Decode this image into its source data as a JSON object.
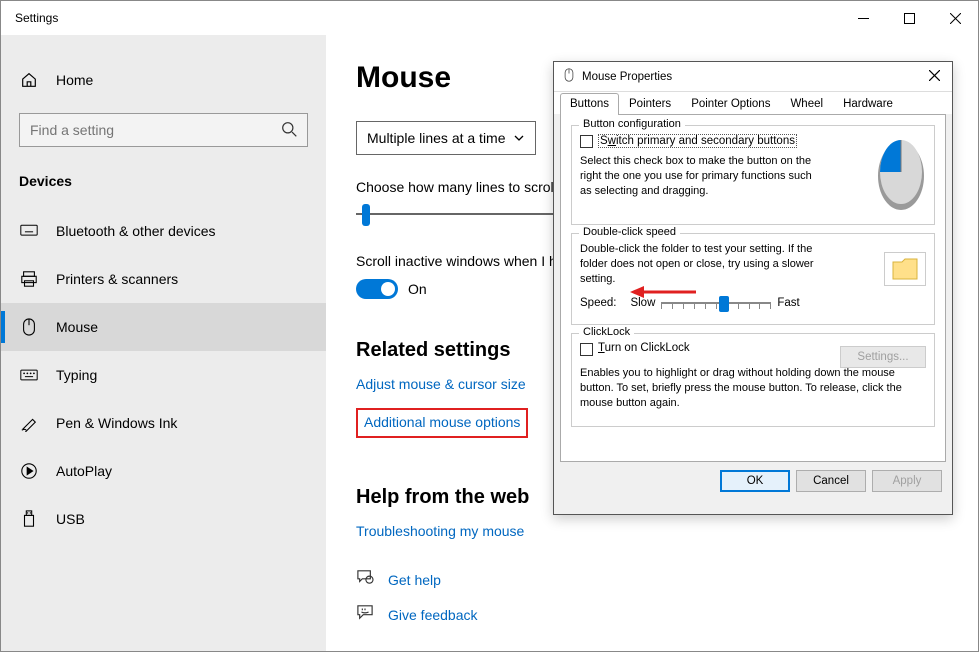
{
  "window": {
    "title": "Settings"
  },
  "sidebar": {
    "home": "Home",
    "search_placeholder": "Find a setting",
    "section": "Devices",
    "items": [
      {
        "label": "Bluetooth & other devices"
      },
      {
        "label": "Printers & scanners"
      },
      {
        "label": "Mouse"
      },
      {
        "label": "Typing"
      },
      {
        "label": "Pen & Windows Ink"
      },
      {
        "label": "AutoPlay"
      },
      {
        "label": "USB"
      }
    ]
  },
  "page": {
    "title": "Mouse",
    "scroll_mode": "Multiple lines at a time",
    "lines_label": "Choose how many lines to scroll each time",
    "inactive_label": "Scroll inactive windows when I hover over them",
    "toggle_state": "On",
    "related_hdr": "Related settings",
    "link_adjust": "Adjust mouse & cursor size",
    "link_additional": "Additional mouse options",
    "help_hdr": "Help from the web",
    "link_trouble": "Troubleshooting my mouse",
    "link_gethelp": "Get help",
    "link_feedback": "Give feedback"
  },
  "dialog": {
    "title": "Mouse Properties",
    "tabs": [
      "Buttons",
      "Pointers",
      "Pointer Options",
      "Wheel",
      "Hardware"
    ],
    "btncfg": {
      "legend": "Button configuration",
      "switch_pre": "S",
      "switch_u": "w",
      "switch_post": "itch primary and secondary buttons",
      "desc": "Select this check box to make the button on the right the one you use for primary functions such as selecting and dragging."
    },
    "dblclick": {
      "legend": "Double-click speed",
      "desc": "Double-click the folder to test your setting. If the folder does not open or close, try using a slower setting.",
      "speed": "Speed:",
      "slow": "Slow",
      "fast": "Fast"
    },
    "clicklock": {
      "legend": "ClickLock",
      "turn_pre": "",
      "turn_u": "T",
      "turn_post": "urn on ClickLock",
      "settings_btn": "Settings...",
      "desc": "Enables you to highlight or drag without holding down the mouse button. To set, briefly press the mouse button. To release, click the mouse button again."
    },
    "buttons": {
      "ok": "OK",
      "cancel": "Cancel",
      "apply": "Apply"
    }
  }
}
